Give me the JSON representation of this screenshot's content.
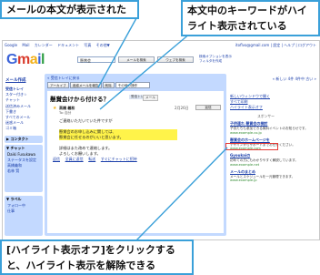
{
  "callouts": {
    "top_left": "メールの本文が表示された",
    "top_right": "本文中のキーワードがハイライト表示されている",
    "bottom": "[ハイライト表示オフ]をクリックすると、ハイライト表示を解除できる"
  },
  "colors": {
    "callout_border": "#3aa0d9",
    "highlight": "#fff34a",
    "link": "#1a3eaa",
    "panel": "#c3d9ff",
    "marker_box": "#e53935"
  },
  "gmail": {
    "topnav": [
      "Google",
      "Mail",
      "カレンダー",
      "ドキュメント",
      "写真",
      "その他▼"
    ],
    "account": "itoflvo@gmail.com | 設定 | ヘルプ | ログアウト",
    "logo": "Gmail",
    "search": {
      "value": "懸賞会",
      "mail_button": "メールを検索",
      "web_button": "ウェブを検索",
      "links": [
        "検索オプションを表示",
        "フィルタを作成"
      ]
    },
    "sidebar": {
      "compose": "メール作成",
      "items": [
        "受信トレイ",
        "スター付き☆",
        "チャット",
        "送信済みメール",
        "下書き",
        "すべてのメール",
        "迷惑メール",
        "ゴミ箱"
      ],
      "contacts_header": "▶ コンタクト",
      "chat_header": "▼ チャット",
      "chat_user": "Daiki Fusukawa",
      "chat_status": "ステータスを設定",
      "chat_links": [
        "高橋義和",
        "若林 賢"
      ],
      "labels_header": "▼ ラベル",
      "labels": [
        "フォロー中",
        "仕事"
      ]
    },
    "message": {
      "back_link": "« 受信トレイに戻る",
      "toolbar": [
        "アーカイブ",
        "迷惑メールを報告",
        "削除"
      ],
      "more_actions": "その他の操作",
      "subject": "懸賞会けから付ける？",
      "inbox_tag": "受信トレイ",
      "label_chip": "メール",
      "sender": "高橋 義和",
      "to": "To: 自分",
      "date": "2月26日",
      "reply": "返信",
      "body_lines": [
        "ご連絡いただいていた件ですが",
        "",
        "懸賞会のお申し込みに関しては、",
        "懸賞会に任せるのがいいと思います。",
        "",
        "詳細はまた改めて連絡します。",
        "よろしくお願いします。"
      ],
      "actions": [
        "返信",
        "全員に返信",
        "転送",
        "すぐにチャットに招待"
      ]
    },
    "right": {
      "pager": "« 新しい 4件 4件中 古い »",
      "links": [
        "新しいウィンドウで開く",
        "すべて印刷",
        "ハイライト表示オフ"
      ],
      "sponsor": "スポンサー",
      "ads": [
        {
          "title": "子供連れ 懸賞会の検討",
          "desc": "子供たちも参加できる無料イベントのお知らせです。",
          "url": "www.example.co.jp"
        },
        {
          "title": "懸賞会のホームページを",
          "desc": "デザインからサポートまでお任せください。",
          "url": "www.example.com"
        },
        {
          "title": "Gyoukaiの",
          "desc": "初めての方にもわかりやすく解説しています。",
          "url": "www.example.net"
        },
        {
          "title": "メールのまとめ",
          "desc": "メールとスケジュールを一元管理できます。",
          "url": "www.example.jp"
        }
      ]
    }
  }
}
